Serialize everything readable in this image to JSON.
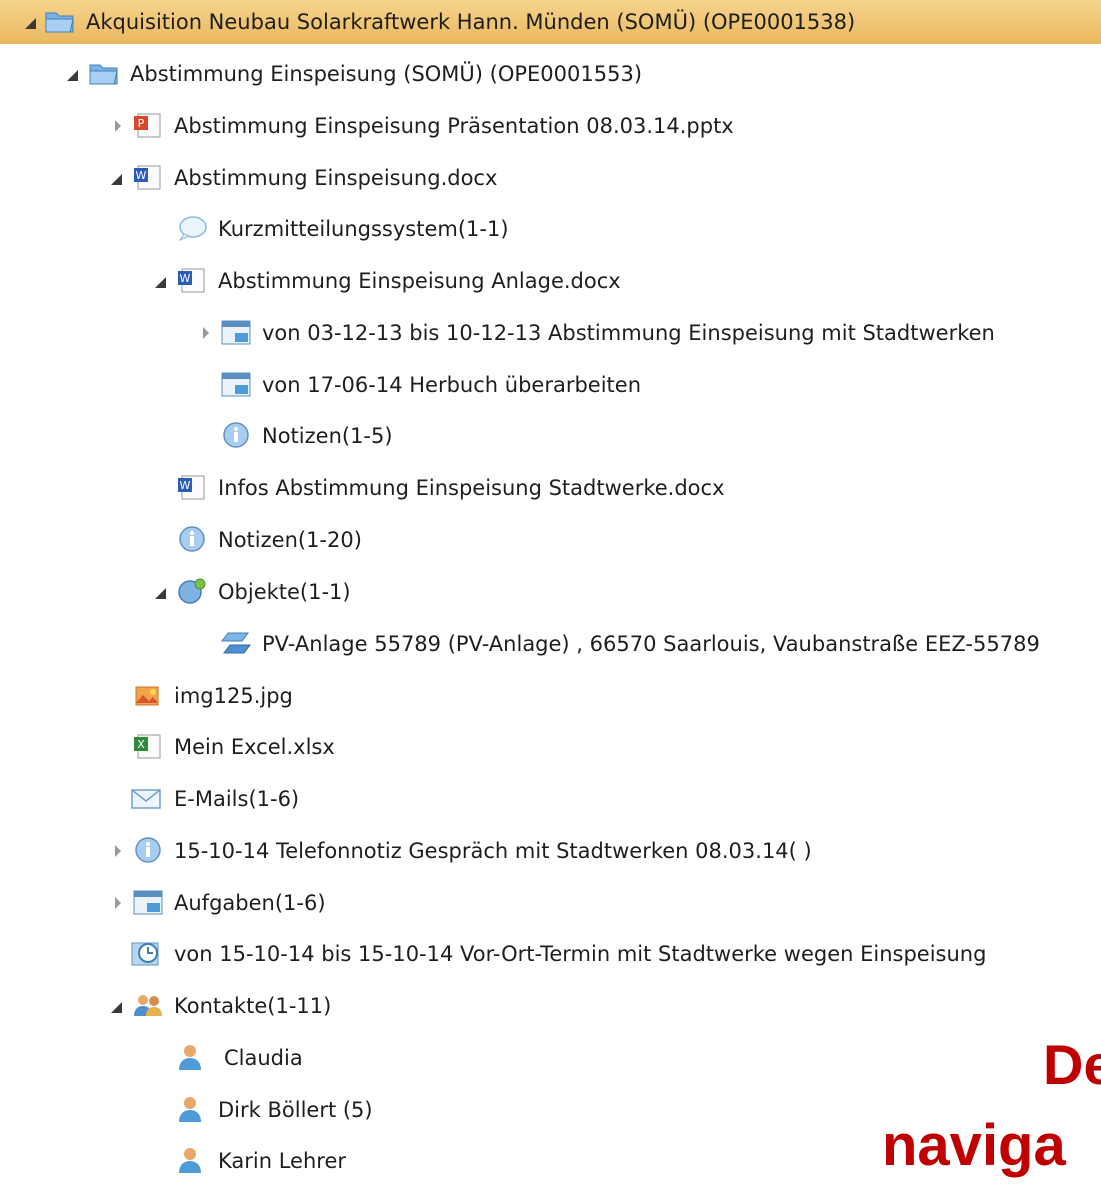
{
  "tree": {
    "root_label": "Akquisition Neubau Solarkraftwerk Hann. Münden (SOMÜ) (OPE0001538)",
    "child_label": "Abstimmung Einspeisung (SOMÜ) (OPE0001553)",
    "pptx_label": "Abstimmung Einspeisung Präsentation 08.03.14.pptx",
    "docx_label": "Abstimmung Einspeisung.docx",
    "kurz_label": "Kurzmitteilungssystem(1-1)",
    "anlage_label": "Abstimmung Einspeisung Anlage.docx",
    "task1_label": "von 03-12-13 bis 10-12-13 Abstimmung Einspeisung mit Stadtwerken",
    "task2_label": "von 17-06-14 Herbuch überarbeiten",
    "notizen5_label": "Notizen(1-5)",
    "infos_label": "Infos Abstimmung Einspeisung Stadtwerke.docx",
    "notizen20_label": "Notizen(1-20)",
    "objekte_label": "Objekte(1-1)",
    "pv_label": "PV-Anlage 55789 (PV-Anlage) , 66570 Saarlouis, Vaubanstraße EEZ-55789",
    "img_label": "img125.jpg",
    "excel_label": "Mein Excel.xlsx",
    "emails_label": "E-Mails(1-6)",
    "tel_label": "15-10-14 Telefonnotiz Gespräch mit Stadtwerken 08.03.14( )",
    "aufgaben_label": "Aufgaben(1-6)",
    "termin_label": "von 15-10-14 bis 15-10-14 Vor-Ort-Termin mit Stadtwerke wegen Einspeisung",
    "kontakte_label": "Kontakte(1-11)",
    "claudia_label": "Claudia",
    "dirk_label": "Dirk Böllert (5)",
    "karin_label": "Karin Lehrer"
  },
  "overlay": {
    "line1": "De",
    "line2": "naviga"
  },
  "colors": {
    "selection": "#eab85e",
    "overlay_text": "#c00000"
  }
}
